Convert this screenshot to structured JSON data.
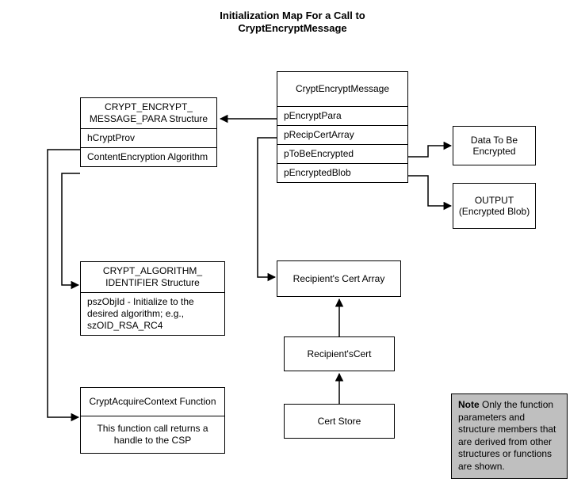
{
  "title_l1": "Initialization Map For a Call to",
  "title_l2": "CryptEncryptMessage",
  "encrypt_para": {
    "header": "CRYPT_ENCRYPT_ MESSAGE_PARA Structure",
    "row1": "hCryptProv",
    "row2": "ContentEncryption Algorithm"
  },
  "alg_id": {
    "header": "CRYPT_ALGORITHM_ IDENTIFIER Structure",
    "row1": "pszObjId - Initialize  to the desired algorithm; e.g., szOID_RSA_RC4"
  },
  "acquire_ctx": {
    "header": "CryptAcquireContext Function",
    "row1": "This function call returns a handle to the CSP"
  },
  "crypt_encrypt_msg": {
    "header": "CryptEncryptMessage",
    "row1": "pEncryptPara",
    "row2": "pRecipCertArray",
    "row3": "pToBeEncrypted",
    "row4": "pEncryptedBlob"
  },
  "data_to_encrypt": "Data To Be Encrypted",
  "output_blob": "OUTPUT (Encrypted Blob)",
  "recipient_array": "Recipient's Cert Array",
  "recipient_cert": "Recipient'sCert",
  "cert_store": "Cert Store",
  "note": {
    "bold": "Note",
    "rest": "  Only the function parameters and structure members that are derived from other structures or functions are shown."
  }
}
